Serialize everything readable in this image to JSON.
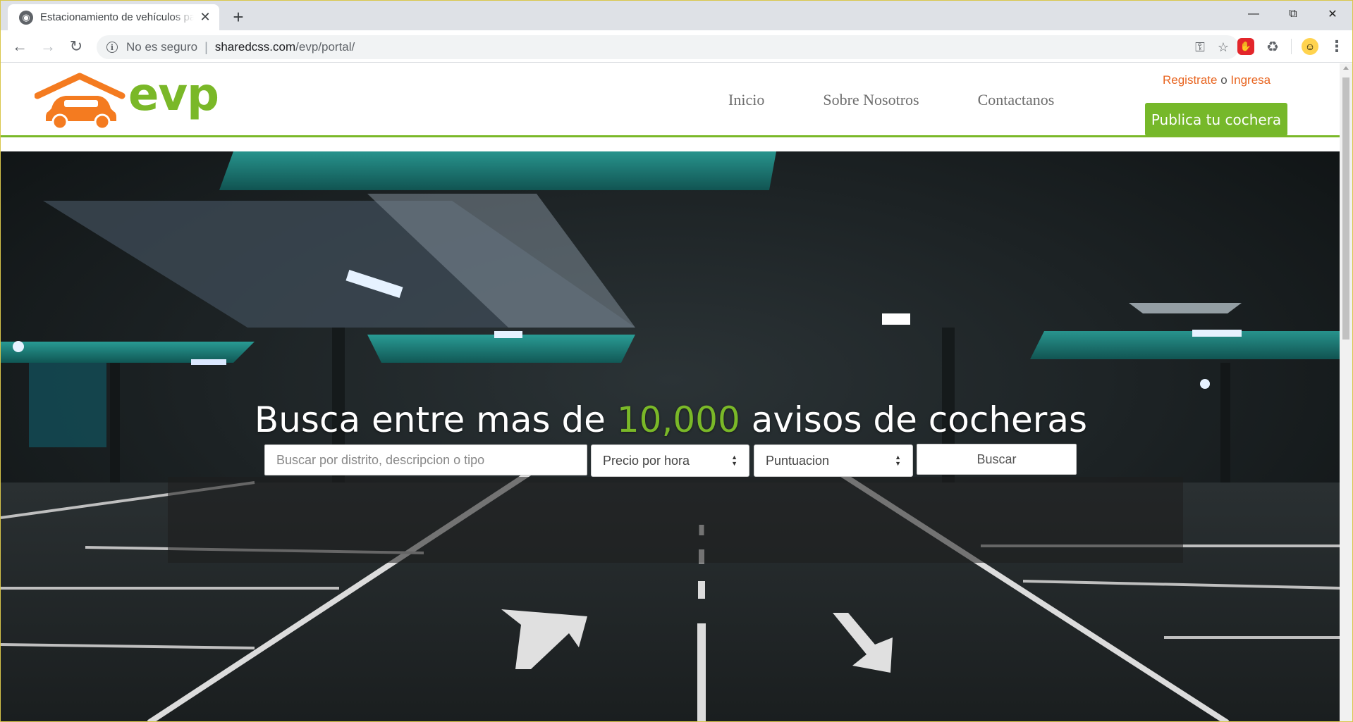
{
  "browser": {
    "tab_title": "Estacionamiento de vehículos para",
    "security_label": "No es seguro",
    "url_host": "sharedcss.com",
    "url_path": "/evp/portal/"
  },
  "site": {
    "logo_text": "evp",
    "nav": [
      "Inicio",
      "Sobre Nosotros",
      "Contactanos"
    ],
    "auth": {
      "register": "Registrate",
      "or": "o",
      "login": "Ingresa"
    },
    "publish_button": "Publica tu cochera"
  },
  "hero": {
    "title_before": "Busca entre mas de ",
    "title_highlight": "10,000",
    "title_after": " avisos de cocheras",
    "search_placeholder": "Buscar por distrito, descripcion o tipo",
    "price_select": "Precio por hora",
    "rating_select": "Puntuacion",
    "search_button": "Buscar"
  },
  "colors": {
    "brand_green": "#7ab828",
    "brand_orange": "#f47b20",
    "link_orange": "#e8641f"
  },
  "icons": {
    "back": "arrow-left-icon",
    "forward": "arrow-right-icon",
    "reload": "reload-icon",
    "info": "info-icon",
    "key": "key-icon",
    "bookmark": "star-icon",
    "adblock": "adblock-icon",
    "recycle": "recycle-icon",
    "profile": "avatar-icon",
    "menu": "kebab-menu-icon"
  }
}
